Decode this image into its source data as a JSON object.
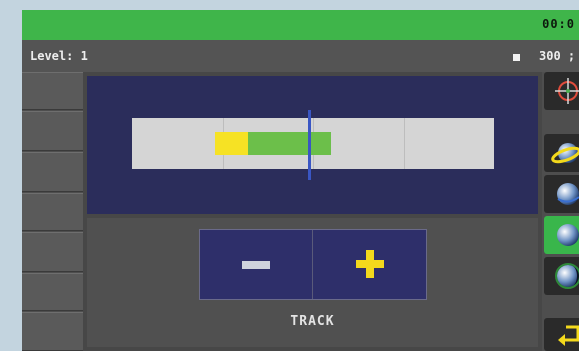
{
  "status_bar": {
    "clock": "00:0"
  },
  "info_bar": {
    "level_text": "Level: 1",
    "count_text": "300 ;"
  },
  "meter": {
    "needle_position": 0.49,
    "marker_yellow": {
      "start": 0.23,
      "end": 0.32
    },
    "marker_green": {
      "start": 0.32,
      "end": 0.55
    }
  },
  "controls": {
    "minus_icon": "minus",
    "plus_icon": "plus",
    "mode_label": "TRACK"
  },
  "right_toolbar": {
    "items": [
      {
        "icon": "crosshair-target-icon",
        "active": false
      },
      {
        "icon": "orbit-yellow-icon",
        "active": false
      },
      {
        "icon": "globe-icon",
        "active": false
      },
      {
        "icon": "globe-icon",
        "active": true
      },
      {
        "icon": "globe-shadow-icon",
        "active": false
      },
      {
        "icon": "return-arrow-icon",
        "active": false
      }
    ]
  },
  "colors": {
    "status_green": "#3fb54a",
    "panel_navy": "#2b2d5b",
    "accent_yellow": "#f3d91c",
    "meter_green": "#6cbf4a",
    "needle_blue": "#3a56c4"
  }
}
